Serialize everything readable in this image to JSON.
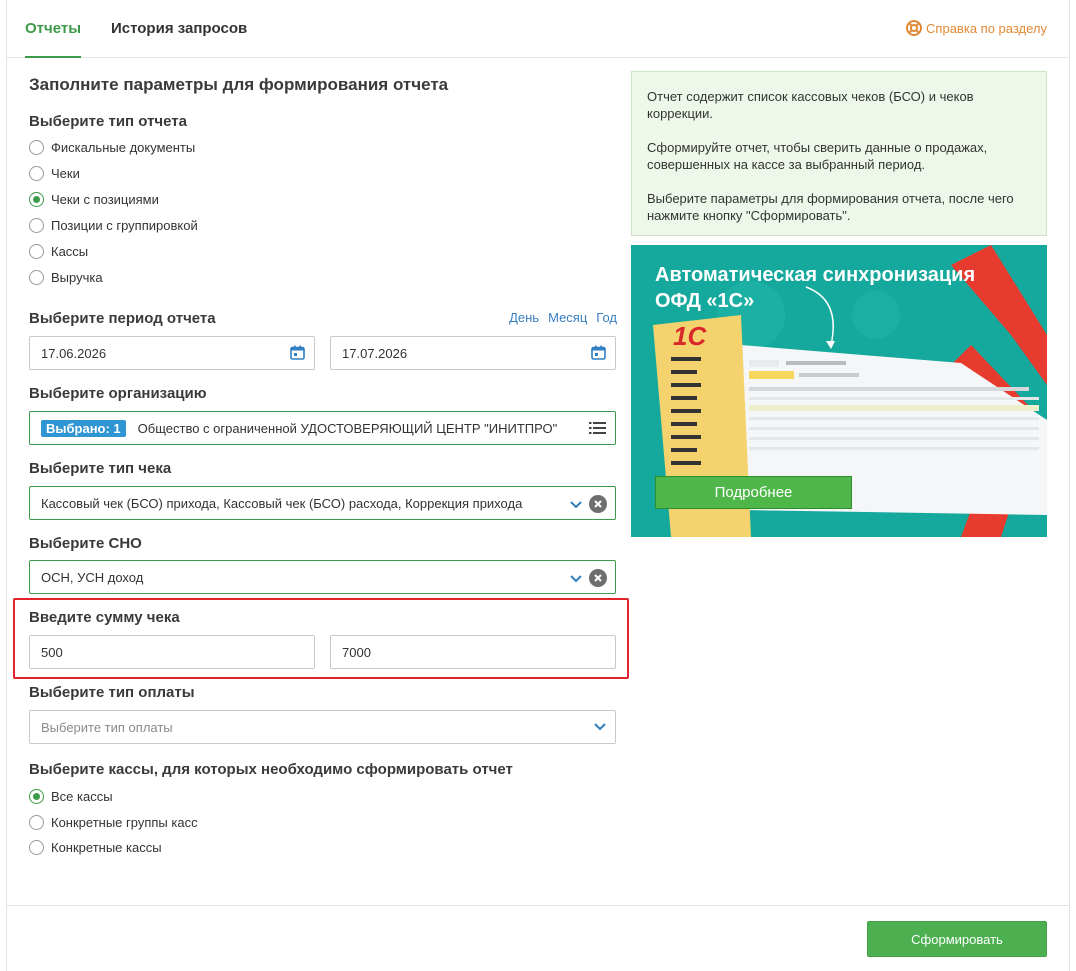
{
  "tabs": [
    {
      "label": "Отчеты",
      "active": true
    },
    {
      "label": "История запросов",
      "active": false
    }
  ],
  "help_label": "Справка по разделу",
  "form": {
    "title": "Заполните параметры для формирования отчета",
    "report_type": {
      "heading": "Выберите тип отчета",
      "options": [
        "Фискальные документы",
        "Чеки",
        "Чеки с позициями",
        "Позиции с группировкой",
        "Кассы",
        "Выручка"
      ],
      "selected": "Чеки с позициями"
    },
    "period": {
      "heading": "Выберите период отчета",
      "links": [
        "День",
        "Месяц",
        "Год"
      ],
      "date_from": "17.06.2026",
      "date_to": "17.07.2026"
    },
    "organization": {
      "heading": "Выберите организацию",
      "badge": "Выбрано: 1",
      "value": "Общество с ограниченной УДОСТОВЕРЯЮЩИЙ ЦЕНТР \"ИНИТПРО\""
    },
    "receipt_type": {
      "heading": "Выберите тип чека",
      "value": "Кассовый чек (БСО) прихода, Кассовый чек (БСО) расхода, Коррекция прихода"
    },
    "tax_system": {
      "heading": "Выберите СНО",
      "value": "ОСН, УСН доход"
    },
    "amount": {
      "heading": "Введите сумму чека",
      "min": "500",
      "max": "7000"
    },
    "payment_type": {
      "heading": "Выберите тип оплаты",
      "placeholder": "Выберите тип оплаты"
    },
    "registers": {
      "heading": "Выберите кассы, для которых необходимо сформировать отчет",
      "options": [
        "Все кассы",
        "Конкретные группы касс",
        "Конкретные кассы"
      ],
      "selected": "Все кассы"
    }
  },
  "info": {
    "paragraphs": [
      "Отчет содержит список кассовых чеков (БСО) и чеков коррекции.",
      "Сформируйте отчет, чтобы сверить данные о продажах, совершенных на кассе за выбранный период.",
      "Выберите параметры для формирования отчета, после чего нажмите кнопку \"Сформировать\"."
    ]
  },
  "banner": {
    "title_line1": "Автоматическая синхронизация",
    "title_line2": "ОФД «1С»",
    "logo": "1С",
    "button": "Подробнее"
  },
  "submit_label": "Сформировать",
  "colors": {
    "accent_green": "#3d9a4a",
    "link_blue": "#3a7fc1",
    "help_orange": "#e08a35",
    "highlight_red": "#e3232b",
    "banner_teal": "#14a99c"
  }
}
